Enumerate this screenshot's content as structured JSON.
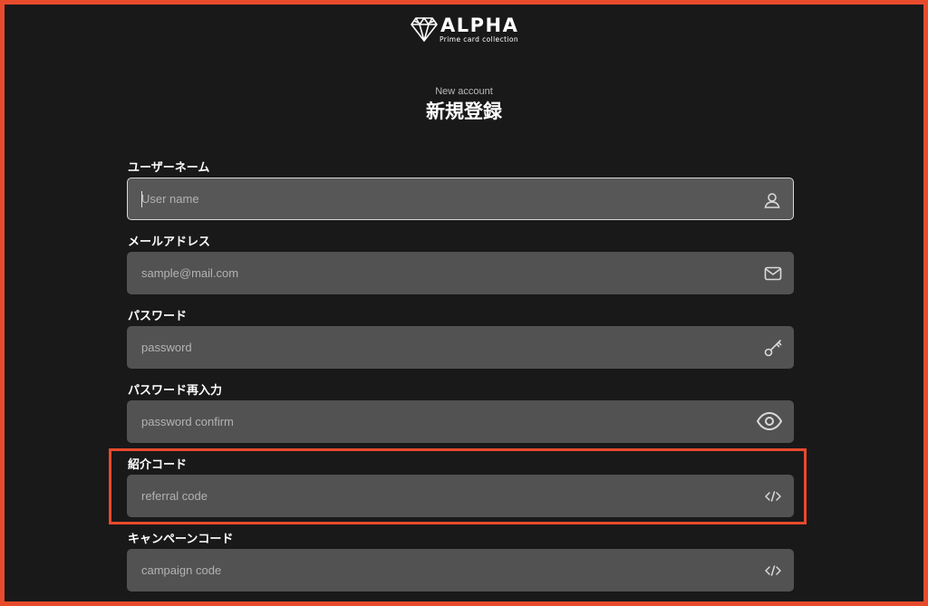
{
  "brand": {
    "name": "ALPHA",
    "tagline": "Prime card collection",
    "logo_icon": "diamond-icon"
  },
  "header": {
    "subtitle": "New account",
    "title": "新規登録"
  },
  "fields": [
    {
      "label": "ユーザーネーム",
      "placeholder": "User name",
      "value": "",
      "icon": "user-icon",
      "focused": true
    },
    {
      "label": "メールアドレス",
      "placeholder": "sample@mail.com",
      "value": "",
      "icon": "mail-icon",
      "focused": false
    },
    {
      "label": "パスワード",
      "placeholder": "password",
      "value": "",
      "icon": "key-icon",
      "focused": false
    },
    {
      "label": "パスワード再入力",
      "placeholder": "password confirm",
      "value": "",
      "icon": "eye-icon",
      "focused": false
    },
    {
      "label": "紹介コード",
      "placeholder": "referral code",
      "value": "",
      "icon": "code-icon",
      "focused": false
    },
    {
      "label": "キャンペーンコード",
      "placeholder": "campaign code",
      "value": "",
      "icon": "code-icon",
      "focused": false
    }
  ],
  "colors": {
    "background": "#1a191a",
    "input_background": "#535253",
    "highlight_border": "#e84a2c",
    "text": "#ffffff",
    "placeholder": "#b2b2b2"
  }
}
